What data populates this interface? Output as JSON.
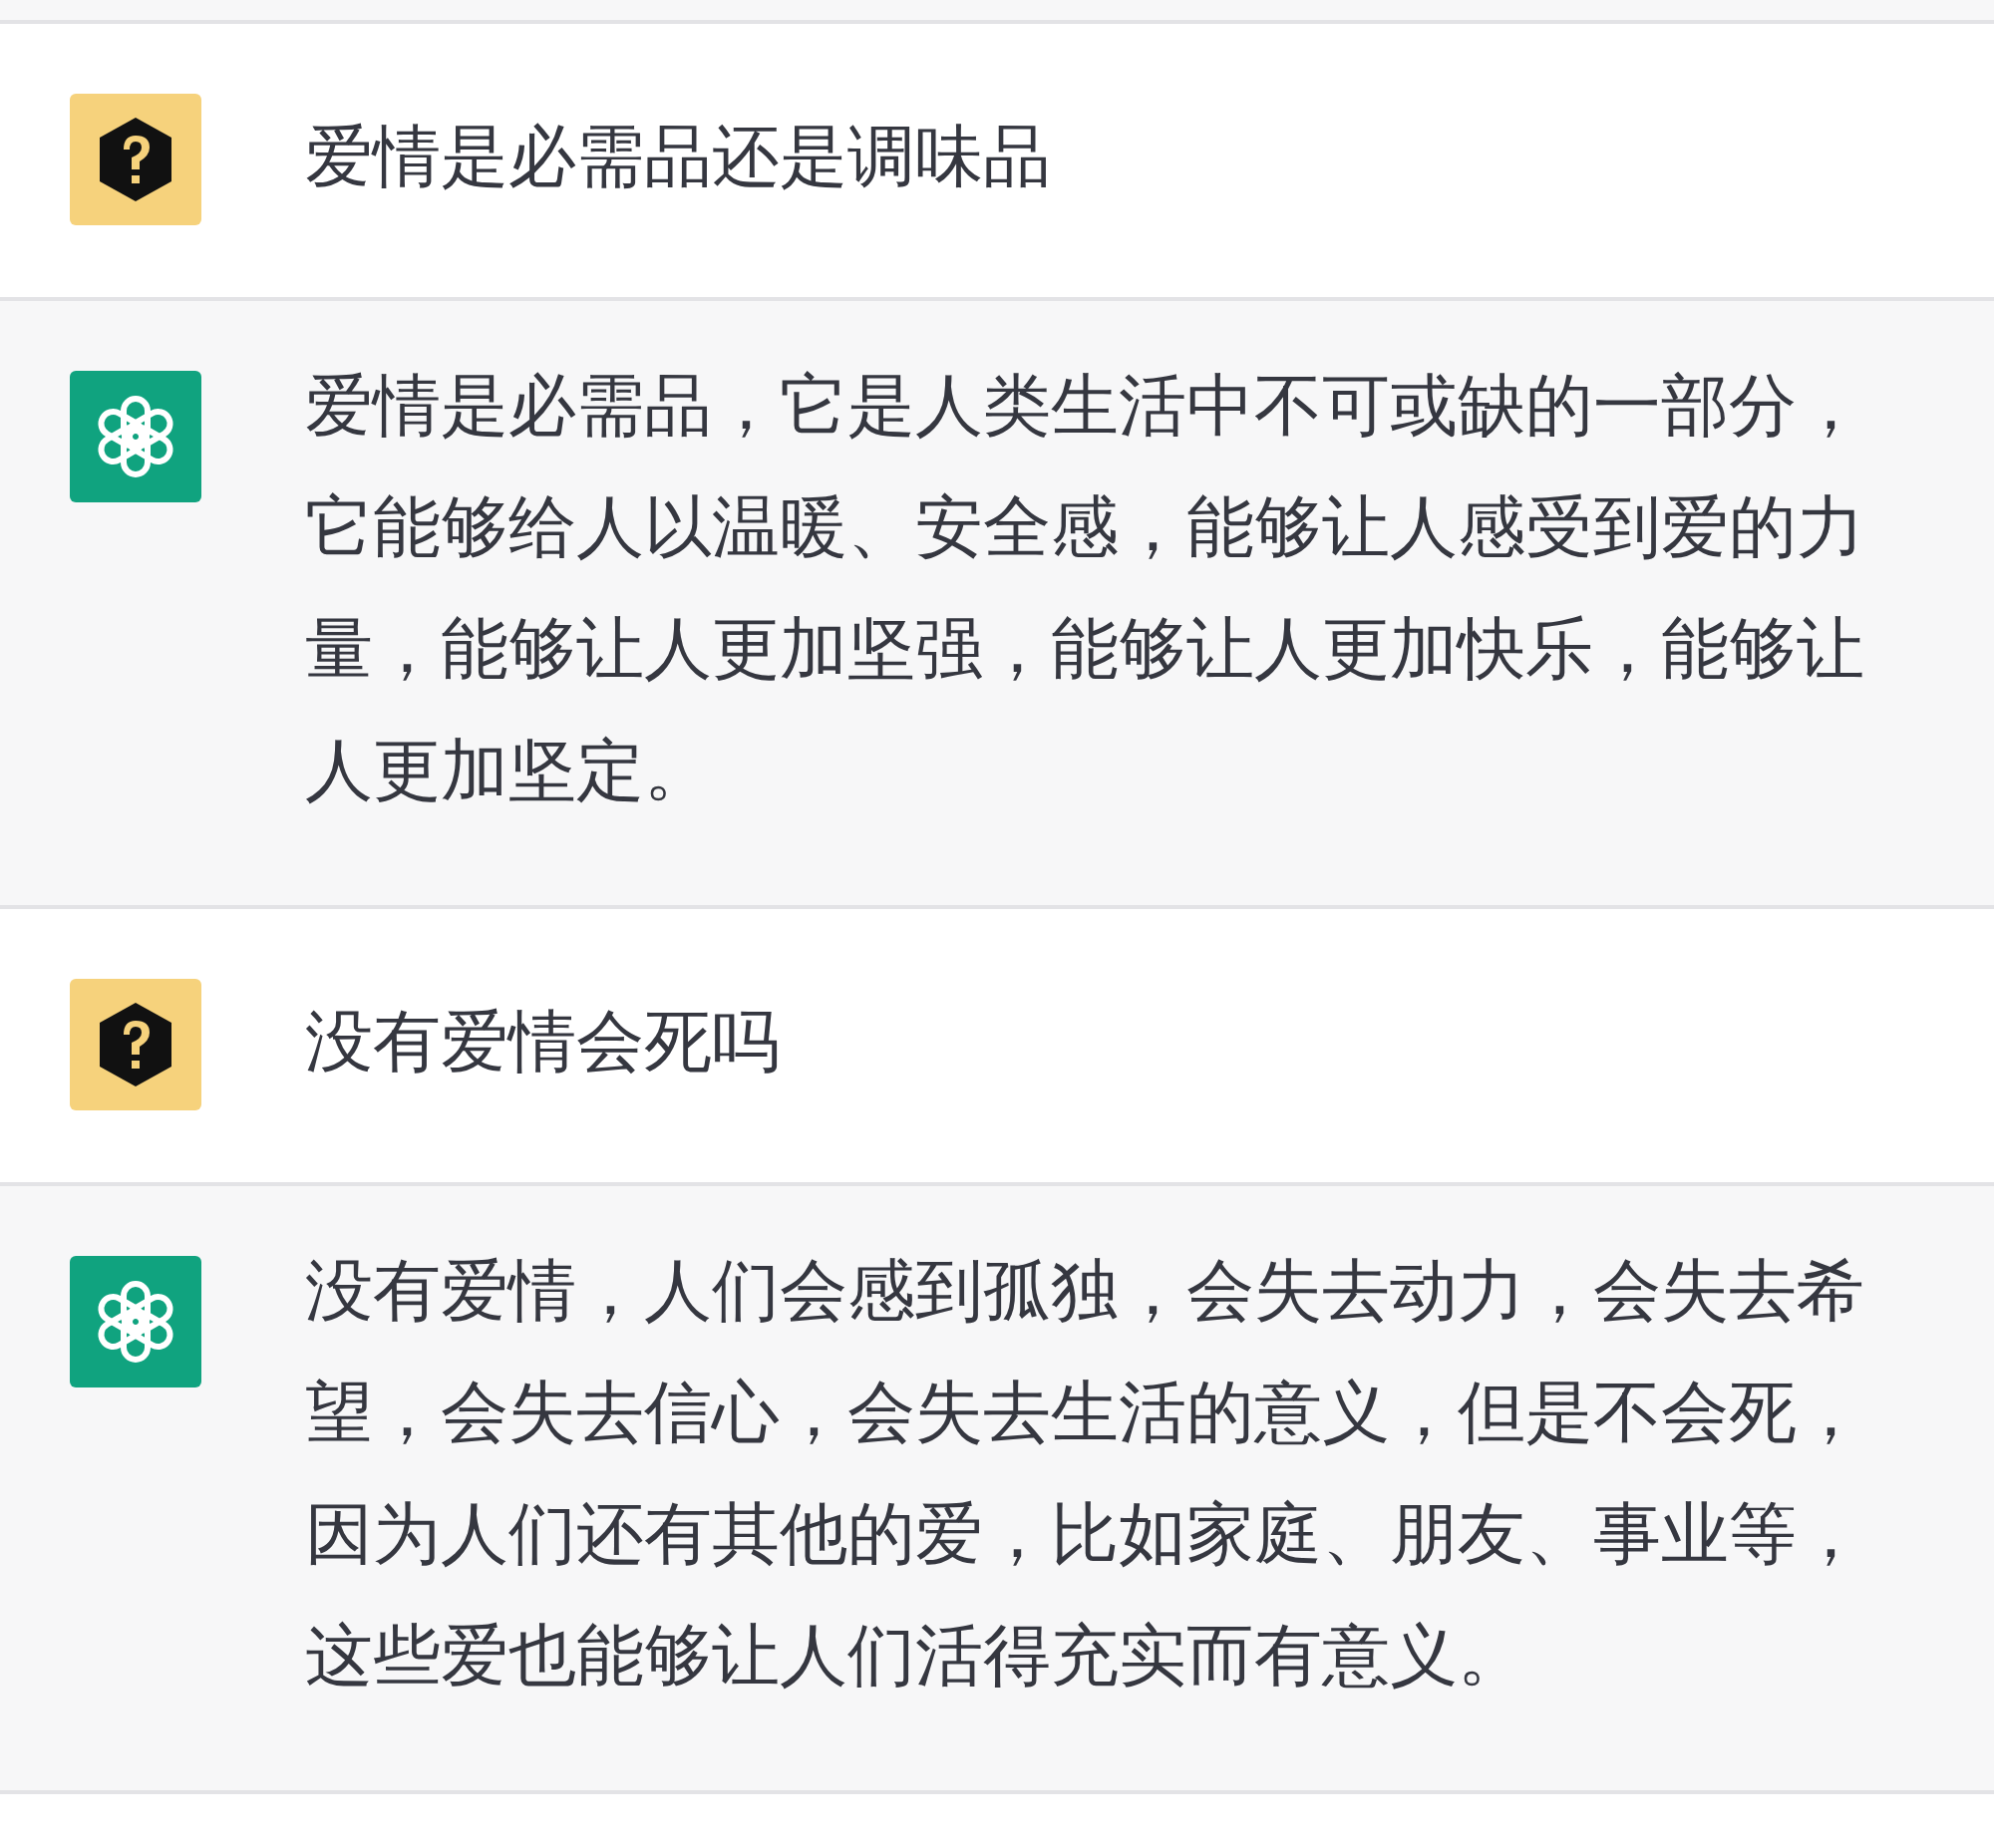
{
  "messages": [
    {
      "kind": "user",
      "text": "爱情是必需品还是调味品"
    },
    {
      "kind": "assistant",
      "text": "爱情是必需品，它是人类生活中不可或缺的一部分，它能够给人以温暖、安全感，能够让人感受到爱的力量，能够让人更加坚强，能够让人更加快乐，能够让人更加坚定。"
    },
    {
      "kind": "user",
      "text": "没有爱情会死吗"
    },
    {
      "kind": "assistant",
      "text": "没有爱情，人们会感到孤独，会失去动力，会失去希望，会失去信心，会失去生活的意义，但是不会死，因为人们还有其他的爱，比如家庭、朋友、事业等，这些爱也能够让人们活得充实而有意义。"
    }
  ]
}
